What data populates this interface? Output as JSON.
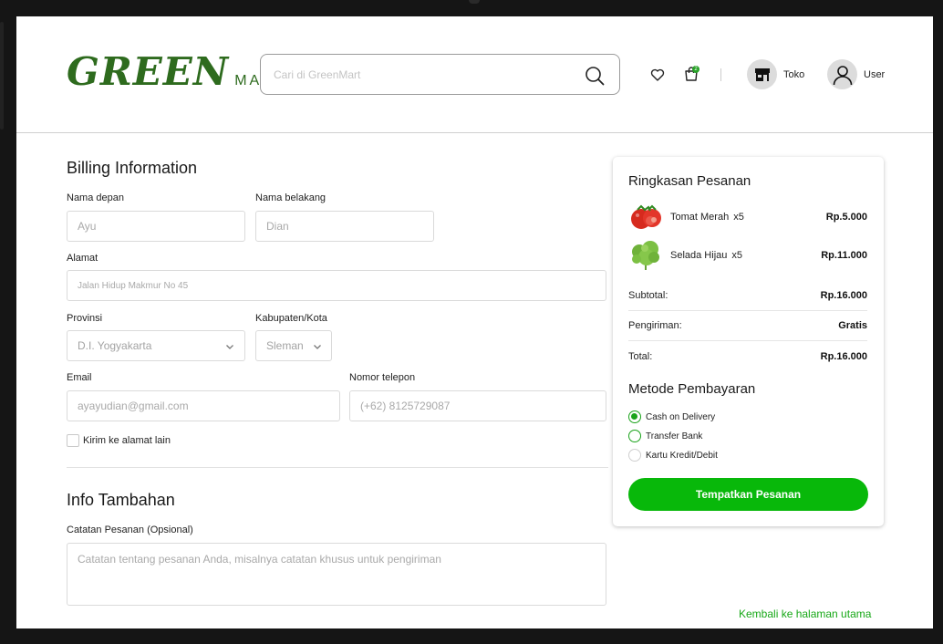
{
  "header": {
    "logo_main": "GREEN",
    "logo_sub": "MART",
    "search_placeholder": "Cari di GreenMart",
    "cart_count": "2",
    "store_label": "Toko",
    "user_label": "User",
    "icons": [
      "search-icon",
      "heart-icon",
      "shopping-bag-icon",
      "store-icon",
      "user-icon"
    ]
  },
  "billing": {
    "title": "Billing Information",
    "first_name": {
      "label": "Nama depan",
      "placeholder": "Ayu"
    },
    "last_name": {
      "label": "Nama belakang",
      "placeholder": "Dian"
    },
    "address": {
      "label": "Alamat",
      "placeholder": "Jalan Hidup Makmur No 45"
    },
    "province": {
      "label": "Provinsi",
      "value": "D.I. Yogyakarta"
    },
    "city": {
      "label": "Kabupaten/Kota",
      "value": "Sleman"
    },
    "email": {
      "label": "Email",
      "placeholder": "ayayudian@gmail.com"
    },
    "phone": {
      "label": "Nomor telepon",
      "placeholder": "(+62) 8125729087"
    },
    "ship_other_label": "Kirim ke alamat lain"
  },
  "extra": {
    "title": "Info Tambahan",
    "notes_label": "Catatan Pesanan (Opsional)",
    "notes_placeholder": "Catatan tentang pesanan Anda, misalnya catatan khusus untuk pengiriman"
  },
  "summary": {
    "title": "Ringkasan Pesanan",
    "items": [
      {
        "name": "Tomat Merah",
        "qty": "x5",
        "price": "Rp.5.000",
        "icon": "tomato-image"
      },
      {
        "name": "Selada Hijau",
        "qty": "x5",
        "price": "Rp.11.000",
        "icon": "lettuce-image"
      }
    ],
    "subtotal_label": "Subtotal:",
    "subtotal_value": "Rp.16.000",
    "shipping_label": "Pengiriman:",
    "shipping_value": "Gratis",
    "total_label": "Total:",
    "total_value": "Rp.16.000"
  },
  "payment": {
    "title": "Metode Pembayaran",
    "options": [
      "Cash on Delivery",
      "Transfer Bank",
      "Kartu Kredit/Debit"
    ],
    "selected": "Cash on Delivery",
    "button_label": "Tempatkan Pesanan"
  },
  "back_link": "Kembali ke halaman utama",
  "colors": {
    "brand": "#2e6b1e",
    "accent": "#08b80a",
    "link": "#17a817"
  }
}
